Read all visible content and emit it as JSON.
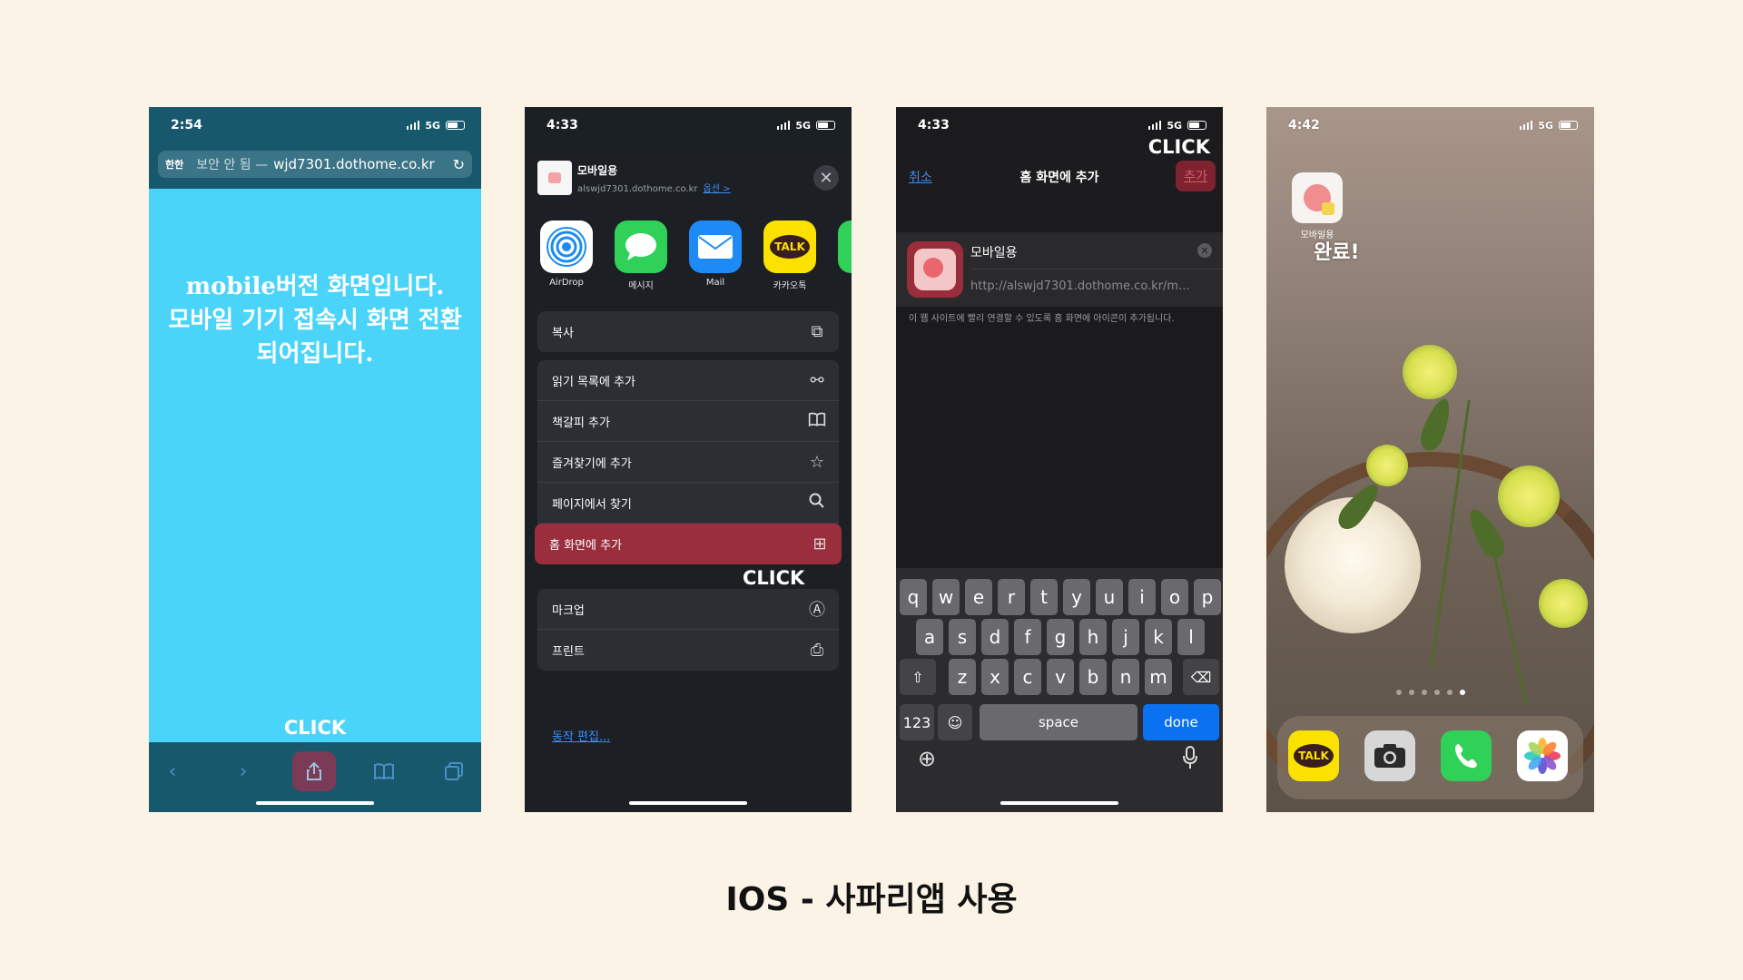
{
  "caption": "IOS - 사파리앱 사용",
  "phone1": {
    "time": "2:54",
    "network": "5G",
    "url_aa": "한한",
    "url_warning": "보안 안 됨 —",
    "url_domain": "wjd7301.dothome.co.kr",
    "content_lines": [
      "mobile버전 화면입니다.",
      "모바일 기기 접속시 화면 전환",
      "되어집니다."
    ],
    "click_label": "CLICK"
  },
  "phone2": {
    "time": "4:33",
    "network": "5G",
    "site_title": "모바일용",
    "site_url": "alswjd7301.dothome.co.kr",
    "options_label": "옵션 >",
    "apps": [
      {
        "label": "AirDrop",
        "icon": "airdrop-icon"
      },
      {
        "label": "메시지",
        "icon": "messages-icon"
      },
      {
        "label": "Mail",
        "icon": "mail-icon"
      },
      {
        "label": "카카오톡",
        "icon": "kakaotalk-icon",
        "icon_text": "TALK"
      }
    ],
    "copy_label": "복사",
    "actions": [
      {
        "label": "읽기 목록에 추가",
        "icon": "glasses-icon"
      },
      {
        "label": "책갈피 추가",
        "icon": "book-icon"
      },
      {
        "label": "즐겨찾기에 추가",
        "icon": "star-icon"
      },
      {
        "label": "페이지에서 찾기",
        "icon": "search-icon"
      },
      {
        "label": "홈 화면에 추가",
        "icon": "add-square-icon"
      }
    ],
    "more_actions": [
      {
        "label": "마크업",
        "icon": "markup-icon"
      },
      {
        "label": "프린트",
        "icon": "printer-icon"
      }
    ],
    "edit_actions": "동작 편집...",
    "click_label": "CLICK"
  },
  "phone3": {
    "time": "4:33",
    "network": "5G",
    "cancel": "취소",
    "title": "홈 화면에 추가",
    "add": "추가",
    "click_label": "CLICK",
    "app_name": "모바일용",
    "app_url": "http://alswjd7301.dothome.co.kr/m...",
    "description": "이 웹 사이트에 빨리 연결할 수 있도록 홈 화면에 아이콘이 추가됩니다.",
    "keyboard_rows": [
      [
        "q",
        "w",
        "e",
        "r",
        "t",
        "y",
        "u",
        "i",
        "o",
        "p"
      ],
      [
        "a",
        "s",
        "d",
        "f",
        "g",
        "h",
        "j",
        "k",
        "l"
      ],
      [
        "z",
        "x",
        "c",
        "v",
        "b",
        "n",
        "m"
      ]
    ],
    "key_123": "123",
    "key_space": "space",
    "key_done": "done"
  },
  "phone4": {
    "time": "4:42",
    "network": "5G",
    "app_label": "모바일용",
    "done_text": "완료!",
    "dock_kakao": "TALK"
  }
}
